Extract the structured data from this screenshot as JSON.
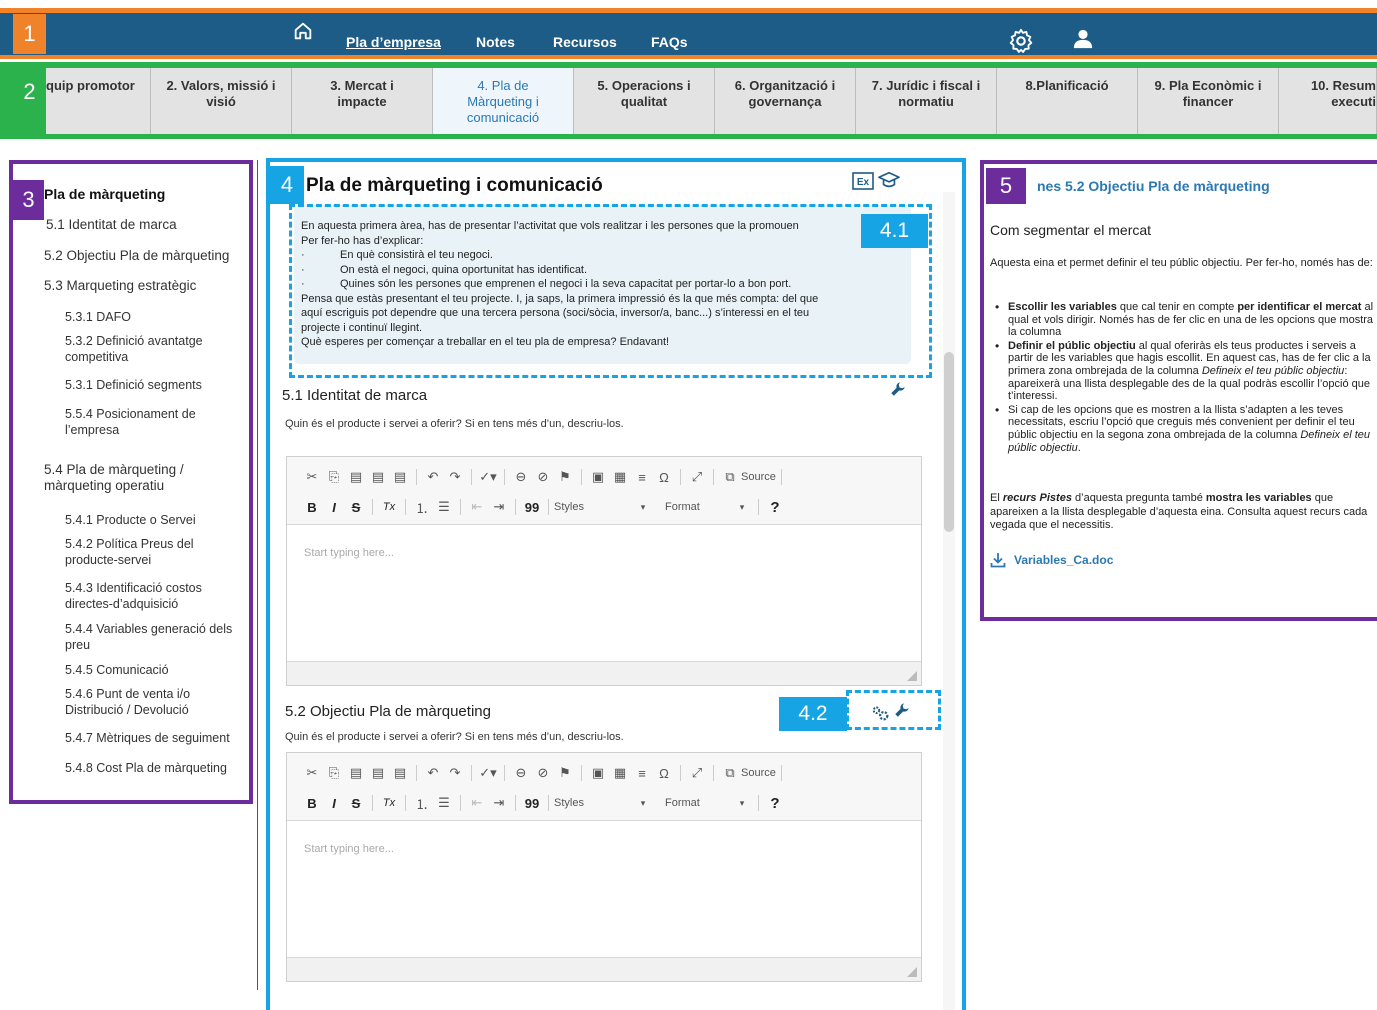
{
  "badges": {
    "b1": "1",
    "b2": "2",
    "b3": "3",
    "b4": "4",
    "b41": "4.1",
    "b42": "4.2",
    "b5": "5"
  },
  "topnav": {
    "links": [
      "Pla d’empresa",
      "Notes",
      "Recursos",
      "FAQs"
    ],
    "icons": {
      "home": "home-icon",
      "settings": "gear-icon",
      "user": "user-icon"
    },
    "colors": {
      "bar": "#1d5c86",
      "accent": "#f0822a"
    }
  },
  "tabs": [
    "quip promotor",
    "2. Valors, missió i visió",
    "3. Mercat i impacte",
    "4. Pla de Màrqueting i comunicació",
    "5. Operacions i qualitat",
    "6. Organització i governança",
    "7. Jurídic i fiscal i normatiu",
    "8.Planificació",
    "9. Pla Econòmic i financer",
    "10. Resum executi"
  ],
  "sidebar": {
    "heading": "Pla de màrqueting",
    "items": [
      "5.1 Identitat de marca",
      "5.2 Objectiu Pla de màrqueting",
      "5.3 Marqueting estratègic",
      "5.3.1 DAFO",
      "5.3.2 Definició avantatge competitiva",
      "5.3.1 Definició segments",
      "5.5.4 Posicionament de l’empresa",
      "5.4 Pla de màrqueting / màrqueting operatiu",
      "5.4.1 Producte o Servei",
      "5.4.2 Política Preus del producte-servei",
      "5.4.3 Identificació costos directes-d’adquisició",
      "5.4.4 Variables generació dels preu",
      "5.4.5 Comunicació",
      "5.4.6 Punt de venta i/o Distribució / Devolució",
      "5.4.7 Mètriques de seguiment",
      "5.4.8 Cost Pla de màrqueting"
    ]
  },
  "center": {
    "title": "Pla de màrqueting i comunicació",
    "intro": {
      "l1": "En aquesta primera àrea, has de presentar l’activitat que vols realitzar i les persones que la promouen",
      "l2": "Per fer-ho has d’explicar:",
      "b1": "En què consistirà el teu negoci.",
      "b2": "On està el negoci, quina oportunitat has identificat.",
      "b3": "Quines són les persones que emprenen el negoci i la seva capacitat per portar-lo a bon port.",
      "l3": "Pensa que estàs presentant el teu projecte. I, ja saps, la primera impressió és la que més compta: del que",
      "l4": "aquí escriguis pot dependre que una tercera persona (soci/sòcia, inversor/a, banc...) s’interessi en el teu",
      "l5": "projecte i continuï llegint.",
      "l6": " Què esperes per començar a treballar en el teu pla de empresa? Endavant!",
      "bullet_char": "·"
    },
    "sections": [
      {
        "title": "5.1 Identitat de marca",
        "desc": "Quin és el producte i servei a oferir? Si en tens més d’un, descriu-los."
      },
      {
        "title": "5.2 Objectiu Pla de màrqueting",
        "desc": "Quin és el producte i servei a oferir? Si en tens més d’un, descriu-los."
      }
    ],
    "editor": {
      "placeholder": "Start typing here...",
      "source_label": "Source",
      "styles_label": "Styles",
      "format_label": "Format",
      "help_label": "?",
      "bold": "B",
      "italic": "I",
      "strike": "S",
      "clear": "Tx",
      "omega": "Ω",
      "quote": "99"
    }
  },
  "rpanel": {
    "title": "nes 5.2 Objectiu Pla de màrqueting",
    "subtitle": "Com segmentar el mercat",
    "intro": "Aquesta eina et permet definir el teu públic objectiu. Per fer-ho, només has de:",
    "items": [
      {
        "b": "Escollir les variables",
        "t1": " que cal tenir en compte ",
        "b2": "per identificar el mercat",
        "t2": " al qual et vols dirigir. Només has de fer clic en una de les opcions que mostra la columna"
      },
      {
        "b": "Definir el públic objectiu",
        "t1": " al qual oferiràs els teus productes i serveis a partir de les variables que hagis escollit. En aquest cas, has de fer clic a la primera zona ombrejada de la columna ",
        "i": "Defineix el teu públic objectiu",
        "t2": ": apareixerà una llista desplegable des de la qual podràs escollir l’opció que t’interessi."
      },
      {
        "t1": "Si cap de les opcions que es mostren a la llista s’adapten a les teves necessitats, escriu l’opció que creguis més convenient per definir el teu públic objectiu en la segona zona ombrejada de la columna ",
        "i": "Defineix el teu públic objectiu",
        "t2": "."
      }
    ],
    "foot": {
      "p1": "El ",
      "bi": "recurs Pistes",
      "p2": " d’aquesta pregunta també ",
      "b": "mostra les variables",
      "p3": " que apareixen a la llista desplegable d’aquesta eina. Consulta aquest recurs cada vegada que el necessitis."
    },
    "file": "Variables_Ca.doc"
  }
}
